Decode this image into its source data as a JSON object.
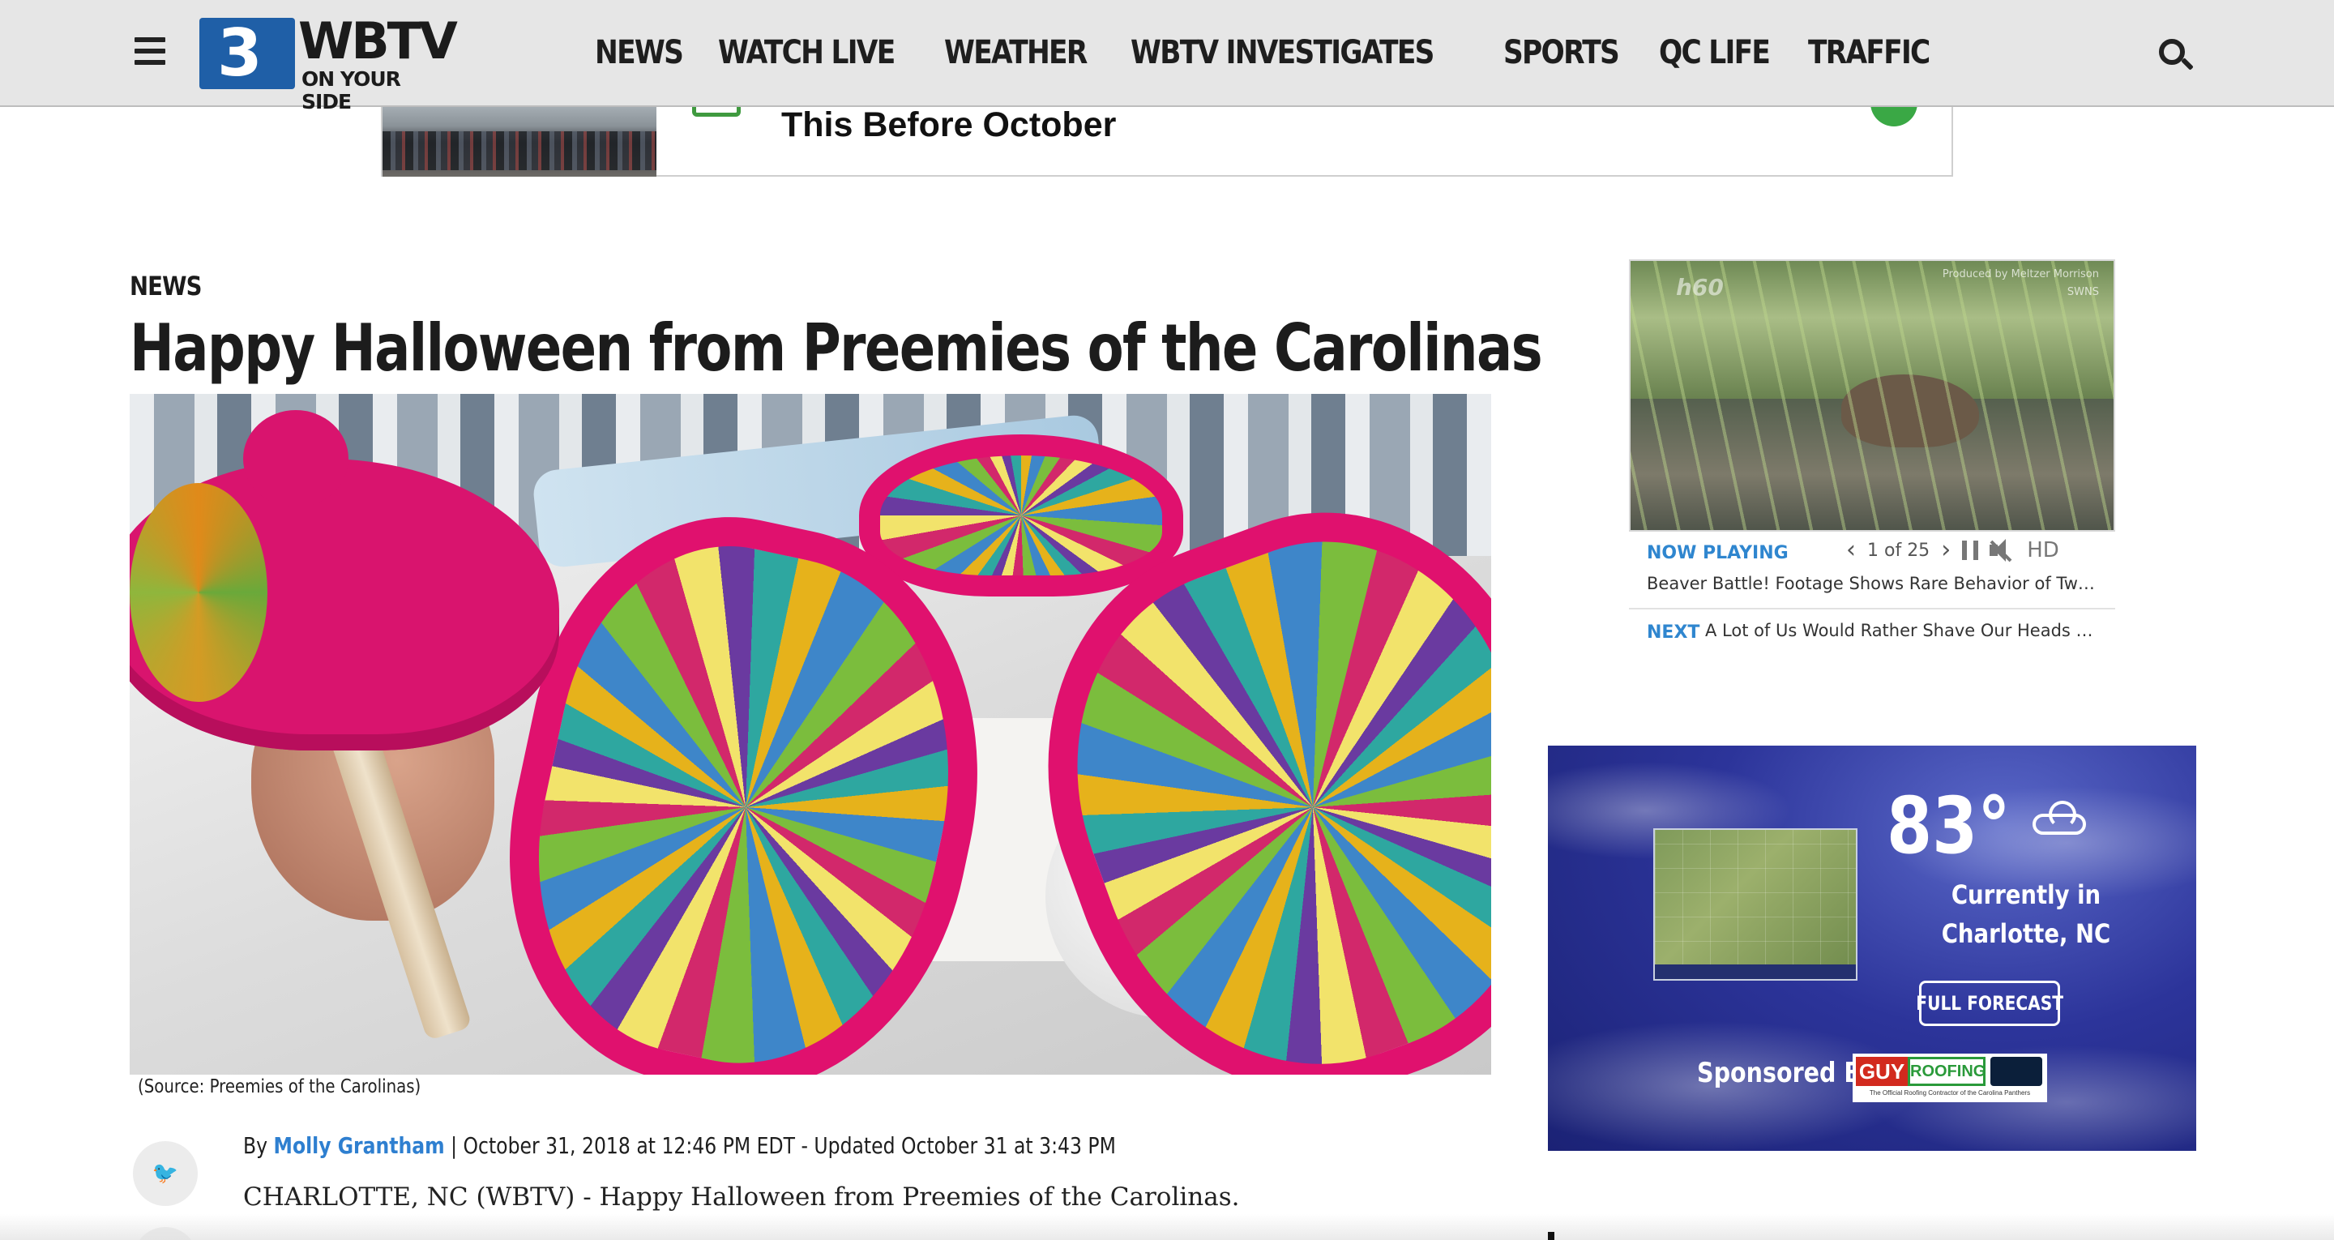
{
  "header": {
    "logo_text": "WBTV",
    "logo_subtext": "ON YOUR SIDE",
    "logo_mark": "3",
    "nav": [
      "NEWS",
      "WATCH LIVE",
      "WEATHER",
      "WBTV INVESTIGATES",
      "SPORTS",
      "QC LIFE",
      "TRAFFIC"
    ],
    "menu_icon": "hamburger-icon",
    "search_icon": "search-icon"
  },
  "ad": {
    "text": "This Before October"
  },
  "article": {
    "section": "NEWS",
    "headline": "Happy Halloween from Preemies of the Carolinas",
    "caption": "(Source: Preemies of the Carolinas)",
    "byline_prefix": "By ",
    "author": "Molly Grantham",
    "dateline": " | October 31, 2018 at 12:46 PM EDT - Updated October 31 at 3:43 PM",
    "lede": "CHARLOTTE, NC (WBTV) - Happy Halloween from Preemies of the Carolinas.",
    "share_icon": "twitter-icon",
    "share_glyph": "🐦"
  },
  "video": {
    "watermark_left": "h60",
    "watermark_right": "Produced by Meltzer Morrison SWNS",
    "now_playing_label": "NOW PLAYING",
    "counter": "1 of 25",
    "prev_glyph": "‹",
    "next_glyph": "›",
    "hd_label": "HD",
    "now_playing_title": "Beaver Battle! Footage Shows Rare Behavior of Two Beavers",
    "next_label": "NEXT",
    "next_title": "A Lot of Us Would Rather Shave Our Heads Than Give Up Social Media"
  },
  "weather": {
    "temperature": "83°",
    "condition_icon": "cloud-icon",
    "location_line1": "Currently in",
    "location_line2": "Charlotte, NC",
    "forecast_button": "FULL FORECAST",
    "sponsored_label": "Sponsored By",
    "sponsor_name_1": "GUY",
    "sponsor_name_2": "ROOFING",
    "sponsor_tagline": "The Official Roofing Contractor of the Carolina Panthers"
  }
}
